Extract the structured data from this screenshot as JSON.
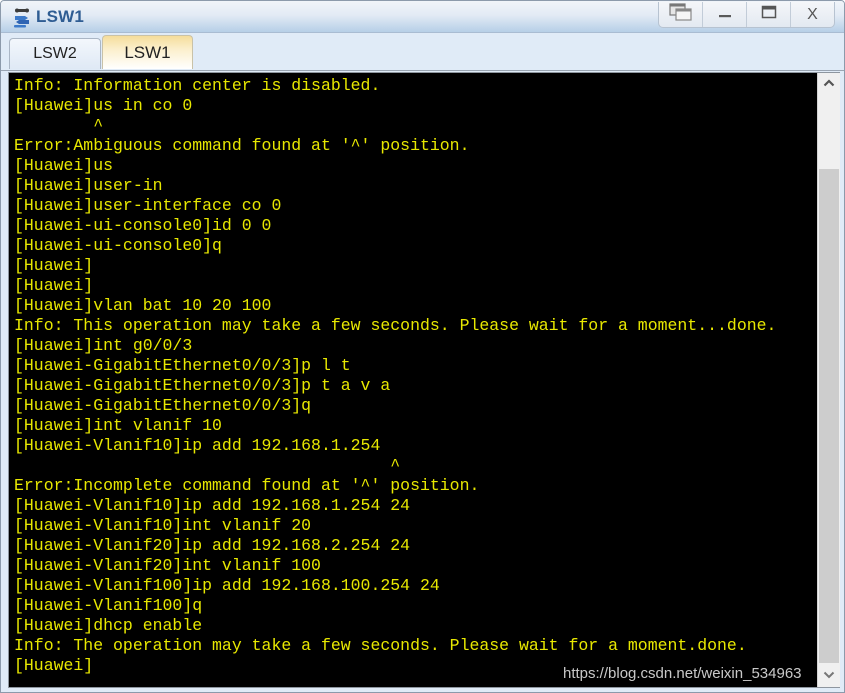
{
  "window": {
    "title": "LSW1",
    "icon": "switch-device-icon",
    "buttons": [
      {
        "name": "cascade-button",
        "icon": "cascade-windows-icon"
      },
      {
        "name": "minimize-button",
        "icon": "minimize-icon",
        "label": "–"
      },
      {
        "name": "maximize-button",
        "icon": "maximize-icon"
      },
      {
        "name": "close-button",
        "icon": "close-icon",
        "label": "X"
      }
    ]
  },
  "tabs": [
    {
      "label": "LSW2",
      "active": false
    },
    {
      "label": "LSW1",
      "active": true
    }
  ],
  "terminal": {
    "text_color": "#e8e800",
    "background_color": "#000000",
    "lines": [
      "Info: Information center is disabled.",
      "[Huawei]us in co 0",
      "        ^",
      "Error:Ambiguous command found at '^' position.",
      "[Huawei]us",
      "[Huawei]user-in",
      "[Huawei]user-interface co 0",
      "[Huawei-ui-console0]id 0 0",
      "[Huawei-ui-console0]q",
      "[Huawei]",
      "[Huawei]",
      "[Huawei]vlan bat 10 20 100",
      "Info: This operation may take a few seconds. Please wait for a moment...done.",
      "[Huawei]int g0/0/3",
      "[Huawei-GigabitEthernet0/0/3]p l t",
      "[Huawei-GigabitEthernet0/0/3]p t a v a",
      "[Huawei-GigabitEthernet0/0/3]q",
      "[Huawei]int vlanif 10",
      "[Huawei-Vlanif10]ip add 192.168.1.254",
      "                                      ^",
      "Error:Incomplete command found at '^' position.",
      "[Huawei-Vlanif10]ip add 192.168.1.254 24",
      "[Huawei-Vlanif10]int vlanif 20",
      "[Huawei-Vlanif20]ip add 192.168.2.254 24",
      "[Huawei-Vlanif20]int vlanif 100",
      "[Huawei-Vlanif100]ip add 192.168.100.254 24",
      "[Huawei-Vlanif100]q",
      "[Huawei]dhcp enable",
      "Info: The operation may take a few seconds. Please wait for a moment.done.",
      "[Huawei]"
    ]
  },
  "scrollbar": {
    "up_icon": "chevron-up-icon",
    "down_icon": "chevron-down-icon",
    "position": "bottom"
  },
  "watermark": "https://blog.csdn.net/weixin_534963"
}
